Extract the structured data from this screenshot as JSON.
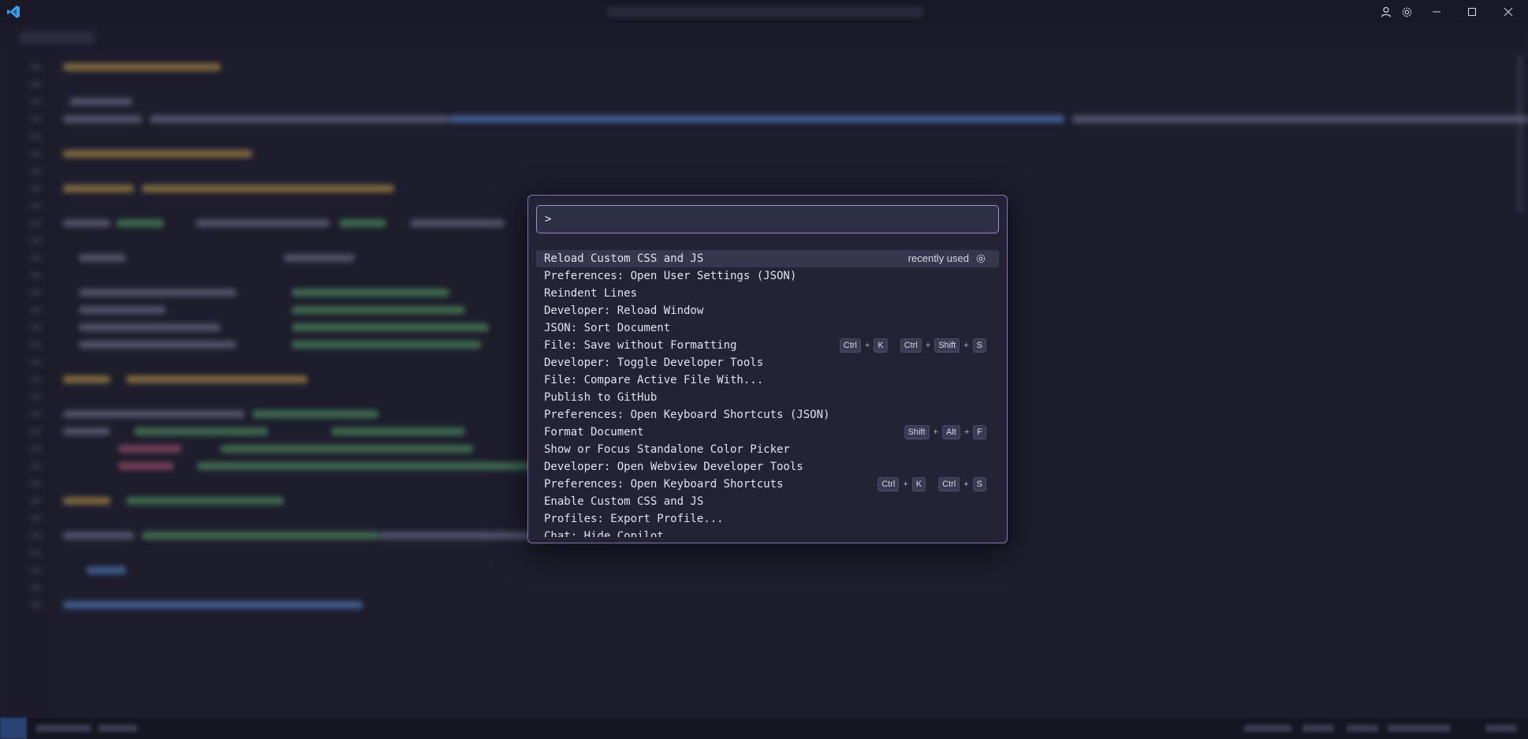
{
  "colors": {
    "accent_border": "#8a6fc4",
    "vscode_blue": "#3e9ce8",
    "palette_bg": "#232335",
    "editor_bg": "#1d1d2c"
  },
  "titlebar": {
    "logo_icon": "vscode-logo-icon",
    "account_icon": "account-icon",
    "settings_icon": "gear-icon",
    "minimize_icon": "minimize-icon",
    "maximize_icon": "maximize-icon",
    "close_icon": "close-icon"
  },
  "palette": {
    "input_value": ">",
    "items": [
      {
        "label": "Reload Custom CSS and JS",
        "badge": "recently used",
        "gear_icon": "gear-icon"
      },
      {
        "label": "Preferences: Open User Settings (JSON)"
      },
      {
        "label": "Reindent Lines"
      },
      {
        "label": "Developer: Reload Window"
      },
      {
        "label": "JSON: Sort Document"
      },
      {
        "label": "File: Save without Formatting",
        "keybinding": [
          [
            "Ctrl",
            "K"
          ],
          [
            "Ctrl",
            "Shift",
            "S"
          ]
        ]
      },
      {
        "label": "Developer: Toggle Developer Tools"
      },
      {
        "label": "File: Compare Active File With..."
      },
      {
        "label": "Publish to GitHub"
      },
      {
        "label": "Preferences: Open Keyboard Shortcuts (JSON)"
      },
      {
        "label": "Format Document",
        "keybinding": [
          [
            "Shift",
            "Alt",
            "F"
          ]
        ]
      },
      {
        "label": "Show or Focus Standalone Color Picker"
      },
      {
        "label": "Developer: Open Webview Developer Tools"
      },
      {
        "label": "Preferences: Open Keyboard Shortcuts",
        "keybinding": [
          [
            "Ctrl",
            "K"
          ],
          [
            "Ctrl",
            "S"
          ]
        ]
      },
      {
        "label": "Enable Custom CSS and JS"
      },
      {
        "label": "Profiles: Export Profile..."
      },
      {
        "label": "Chat: Hide Copilot"
      }
    ]
  }
}
